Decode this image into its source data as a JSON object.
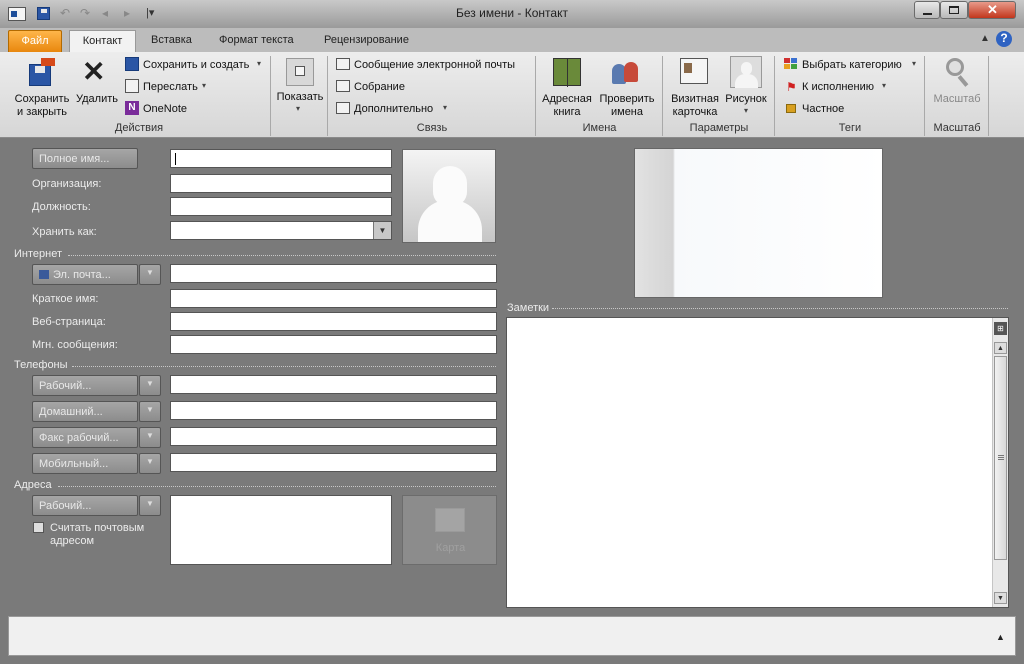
{
  "window": {
    "title": "Без имени - Контакт"
  },
  "tabs": [
    "Файл",
    "Контакт",
    "Вставка",
    "Формат текста",
    "Рецензирование"
  ],
  "ribbon": {
    "actions": {
      "save_close": "Сохранить\nи закрыть",
      "delete": "Удалить",
      "save_new": "Сохранить и создать",
      "forward": "Переслать",
      "onenote": "OneNote",
      "label": "Действия"
    },
    "show": {
      "label_btn": "Показать"
    },
    "communicate": {
      "email": "Сообщение электронной почты",
      "meeting": "Собрание",
      "more": "Дополнительно",
      "label": "Связь"
    },
    "names": {
      "address_book": "Адресная\nкнига",
      "check_names": "Проверить\nимена",
      "label": "Имена"
    },
    "options": {
      "business_card": "Визитная\nкарточка",
      "picture": "Рисунок",
      "label": "Параметры"
    },
    "tags": {
      "categorize": "Выбрать категорию",
      "followup": "К исполнению",
      "private": "Частное",
      "label": "Теги"
    },
    "zoom": {
      "btn": "Масштаб",
      "label": "Масштаб"
    }
  },
  "form": {
    "full_name_btn": "Полное имя...",
    "company": "Организация:",
    "job_title": "Должность:",
    "file_as": "Хранить как:",
    "internet": "Интернет",
    "email_btn": "Эл. почта...",
    "display_as": "Краткое имя:",
    "web_page": "Веб-страница:",
    "im_address": "Мгн. сообщения:",
    "phones": "Телефоны",
    "phone_business": "Рабочий...",
    "phone_home": "Домашний...",
    "phone_fax": "Факс рабочий...",
    "phone_mobile": "Мобильный...",
    "addresses": "Адреса",
    "address_business": "Рабочий...",
    "mailing_check": "Считать почтовым\nадресом",
    "map": "Карта",
    "notes": "Заметки"
  },
  "colors": {
    "file_tab": "#e8870e",
    "form_bg": "#7a7a7a"
  }
}
